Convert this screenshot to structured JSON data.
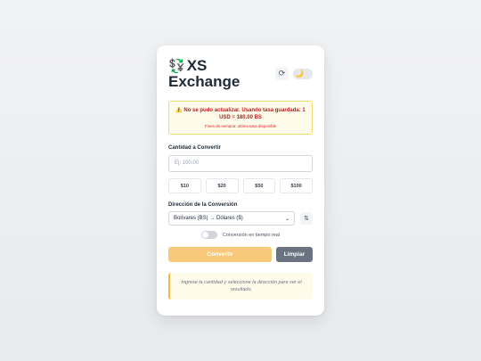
{
  "app": {
    "logo_glyph": "💱",
    "title": "XS Exchange"
  },
  "header": {
    "refresh_glyph": "⟳",
    "theme_glyph": "🌙"
  },
  "alert": {
    "message": "⚠️ No se pudo actualizar. Usando tasa guardada: 1 USD = 180.00 BS",
    "detail": "Fines de semana: ultima tasa disponible"
  },
  "amount": {
    "label": "Cantidad a Convertir",
    "placeholder": "Ej: 100.00",
    "quick_amounts": [
      "$10",
      "$20",
      "$50",
      "$100"
    ]
  },
  "direction": {
    "label": "Dirección de la Conversión",
    "selected": "Bolívares (BS) → Dólares ($)",
    "chevron": "⌄",
    "swap_glyph": "⇅"
  },
  "realtime": {
    "label": "Conversión en tiempo real",
    "enabled": false
  },
  "actions": {
    "convert_label": "Convertir",
    "clear_label": "Limpiar"
  },
  "result": {
    "message": "Ingrese la cantidad y seleccione la dirección para ver el resultado."
  },
  "colors": {
    "accent": "#f8c97a",
    "alert_text": "#b91c1c",
    "alert_bg": "#fffbea",
    "secondary_button": "#6b7280"
  }
}
